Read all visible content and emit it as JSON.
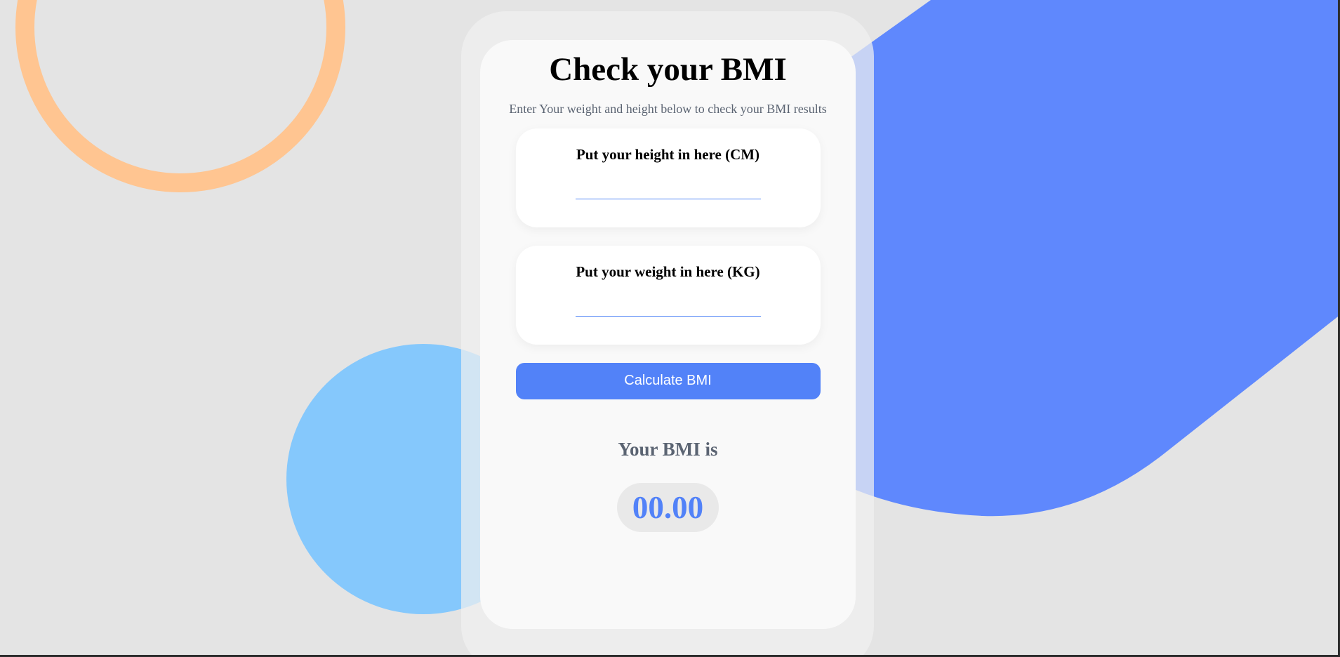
{
  "app": {
    "title": "Check your BMI",
    "subtitle": "Enter Your weight and height below to check your BMI results"
  },
  "form": {
    "height": {
      "label": "Put your height in here (CM)",
      "value": "",
      "placeholder": ""
    },
    "weight": {
      "label": "Put your weight in here (KG)",
      "value": "",
      "placeholder": ""
    },
    "calculate_label": "Calculate BMI"
  },
  "result": {
    "label": "Your BMI is",
    "value": "00.00"
  },
  "colors": {
    "accent": "#5282f8",
    "page_background": "#e4e4e4",
    "ring": "#ffc591",
    "circle": "#85c8fc",
    "blob": "#5f88fd",
    "muted_text": "#5b6472"
  }
}
